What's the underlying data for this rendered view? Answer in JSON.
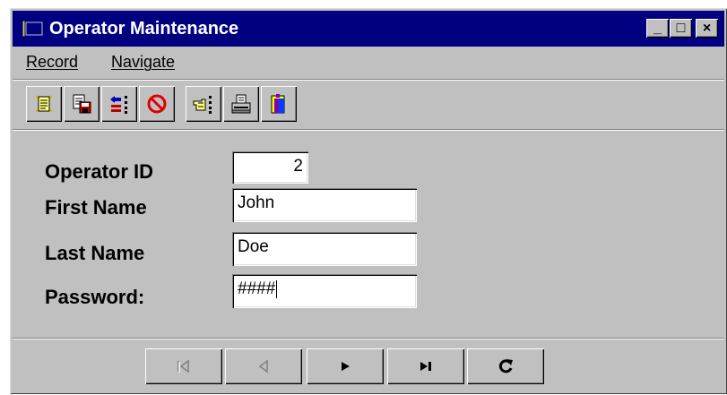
{
  "window": {
    "title": "Operator Maintenance",
    "controls": {
      "minimize": "_",
      "maximize": "□",
      "close": "×"
    }
  },
  "menu": [
    {
      "label": "Record"
    },
    {
      "label": "Navigate"
    }
  ],
  "toolbar": [
    {
      "icon": "new-record-icon"
    },
    {
      "icon": "save-record-icon"
    },
    {
      "icon": "undo-changes-icon"
    },
    {
      "icon": "delete-record-icon"
    },
    {
      "icon": "find-record-icon"
    },
    {
      "icon": "print-icon"
    },
    {
      "icon": "exit-icon"
    }
  ],
  "form": {
    "operator_id": {
      "label": "Operator ID",
      "value": "2"
    },
    "first_name": {
      "label": "First Name",
      "value": "John"
    },
    "last_name": {
      "label": "Last Name",
      "value": "Doe"
    },
    "password": {
      "label": "Password:",
      "value": "####"
    }
  },
  "nav": {
    "first": "first-record-icon",
    "previous": "previous-record-icon",
    "next": "next-record-icon",
    "last": "last-record-icon",
    "refresh": "refresh-icon"
  },
  "colors": {
    "titlebar": "#000080",
    "face": "#c0c0c0",
    "disabled": "#808080"
  }
}
